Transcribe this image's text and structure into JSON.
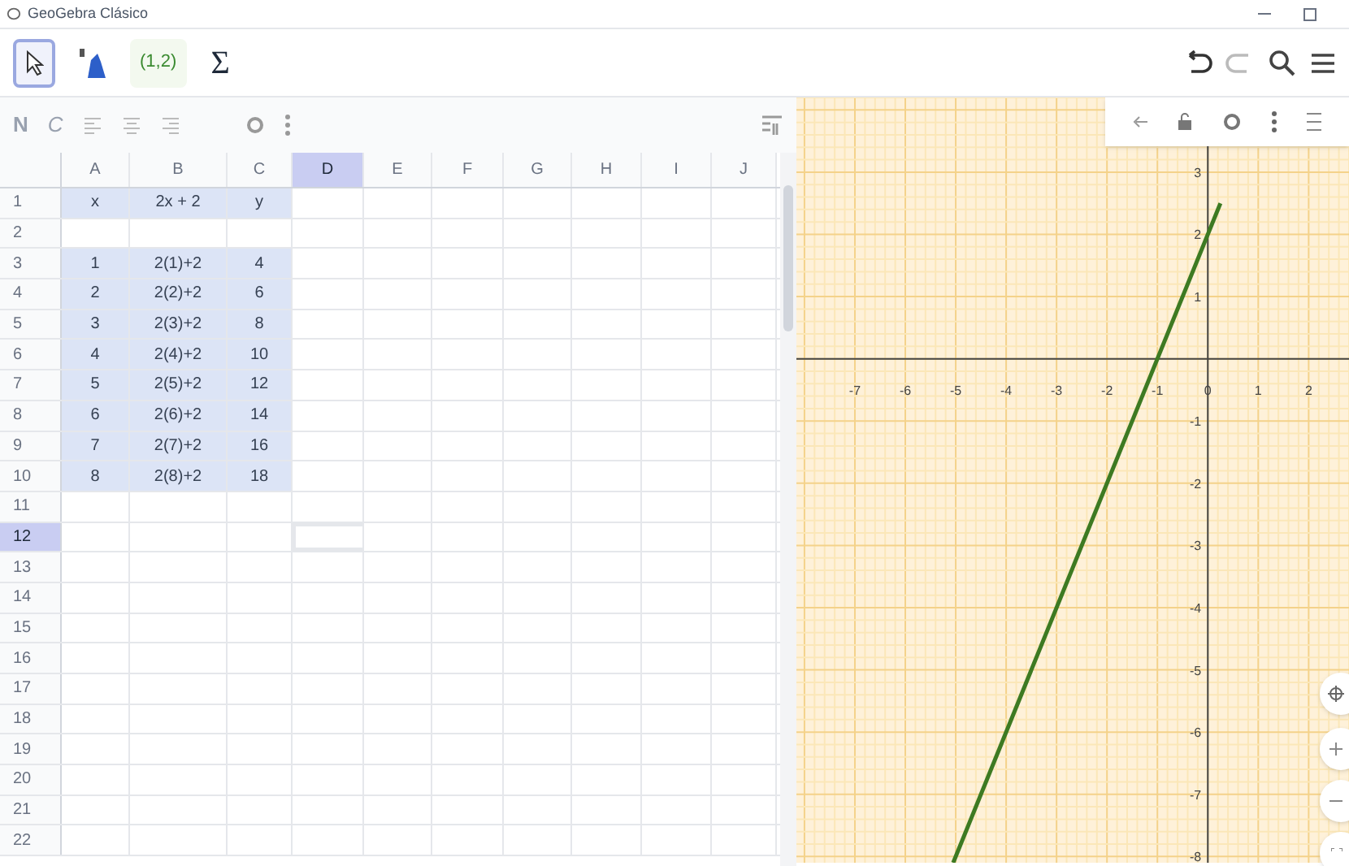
{
  "window": {
    "title": "GeoGebra Clásico"
  },
  "toolbar": {
    "tools": [
      {
        "kind": "move",
        "selected": true
      },
      {
        "kind": "regression",
        "selected": false
      },
      {
        "kind": "list",
        "label": "(1,2)",
        "selected": false
      },
      {
        "kind": "sum",
        "label": "Σ",
        "selected": false
      }
    ]
  },
  "spreadsheet_style_bar": {
    "bold": "N",
    "italic": "C"
  },
  "columns": [
    {
      "label": "A",
      "selected": false
    },
    {
      "label": "B",
      "selected": false
    },
    {
      "label": "C",
      "selected": false
    },
    {
      "label": "D",
      "selected": true
    },
    {
      "label": "E",
      "selected": false
    },
    {
      "label": "F",
      "selected": false
    },
    {
      "label": "G",
      "selected": false
    },
    {
      "label": "H",
      "selected": false
    },
    {
      "label": "I",
      "selected": false
    },
    {
      "label": "J",
      "selected": false
    }
  ],
  "rows": [
    {
      "label": "1",
      "selected": false,
      "highlighted": true,
      "cells": [
        "x",
        "2x + 2",
        "y"
      ]
    },
    {
      "label": "2",
      "selected": false,
      "highlighted": false,
      "cells": []
    },
    {
      "label": "3",
      "selected": false,
      "highlighted": true,
      "cells": [
        "1",
        "2(1)+2",
        "4"
      ]
    },
    {
      "label": "4",
      "selected": false,
      "highlighted": true,
      "cells": [
        "2",
        "2(2)+2",
        "6"
      ]
    },
    {
      "label": "5",
      "selected": false,
      "highlighted": true,
      "cells": [
        "3",
        "2(3)+2",
        "8"
      ]
    },
    {
      "label": "6",
      "selected": false,
      "highlighted": true,
      "cells": [
        "4",
        "2(4)+2",
        "10"
      ]
    },
    {
      "label": "7",
      "selected": false,
      "highlighted": true,
      "cells": [
        "5",
        "2(5)+2",
        "12"
      ]
    },
    {
      "label": "8",
      "selected": false,
      "highlighted": true,
      "cells": [
        "6",
        "2(6)+2",
        "14"
      ]
    },
    {
      "label": "9",
      "selected": false,
      "highlighted": true,
      "cells": [
        "7",
        "2(7)+2",
        "16"
      ]
    },
    {
      "label": "10",
      "selected": false,
      "highlighted": true,
      "cells": [
        "8",
        "2(8)+2",
        "18"
      ]
    },
    {
      "label": "11",
      "selected": false,
      "highlighted": false,
      "cells": []
    },
    {
      "label": "12",
      "selected": true,
      "highlighted": false,
      "cells": []
    },
    {
      "label": "13",
      "selected": false,
      "highlighted": false,
      "cells": []
    },
    {
      "label": "14",
      "selected": false,
      "highlighted": false,
      "cells": []
    },
    {
      "label": "15",
      "selected": false,
      "highlighted": false,
      "cells": []
    },
    {
      "label": "16",
      "selected": false,
      "highlighted": false,
      "cells": []
    },
    {
      "label": "17",
      "selected": false,
      "highlighted": false,
      "cells": []
    },
    {
      "label": "18",
      "selected": false,
      "highlighted": false,
      "cells": []
    },
    {
      "label": "19",
      "selected": false,
      "highlighted": false,
      "cells": []
    },
    {
      "label": "20",
      "selected": false,
      "highlighted": false,
      "cells": []
    },
    {
      "label": "21",
      "selected": false,
      "highlighted": false,
      "cells": []
    },
    {
      "label": "22",
      "selected": false,
      "highlighted": false,
      "cells": []
    }
  ],
  "graphics": {
    "chart_data": {
      "type": "line",
      "grid": true,
      "series": [
        {
          "color": "#3d7a22",
          "values": [
            -8.1,
            2.5
          ]
        }
      ],
      "x": [
        -5.05,
        0.25
      ],
      "xlim": [
        -8.16,
        2.8
      ],
      "ylim": [
        -8.1,
        4.2
      ],
      "xticks": [
        -7,
        -6,
        -5,
        -4,
        -3,
        -2,
        -1,
        0,
        1,
        2
      ],
      "yticks": [
        -8,
        -7,
        -6,
        -5,
        -4,
        -3,
        -2,
        -1,
        1,
        2,
        3
      ]
    }
  }
}
